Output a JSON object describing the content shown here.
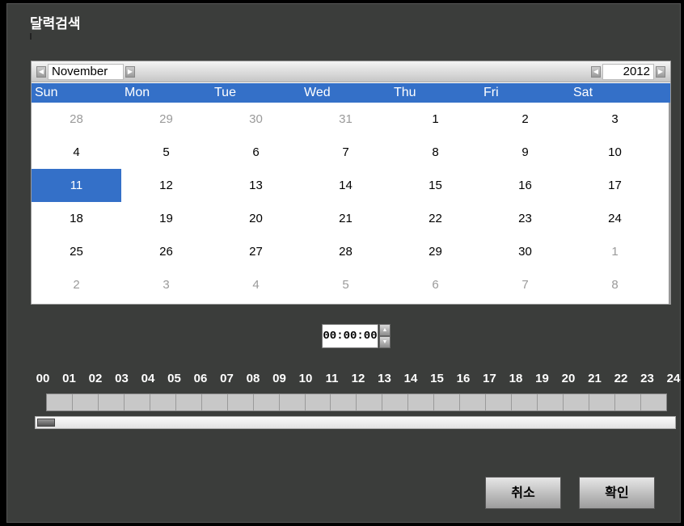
{
  "window": {
    "title": "달력검색"
  },
  "calendar": {
    "month": "November",
    "year": "2012",
    "weekdays": [
      "Sun",
      "Mon",
      "Tue",
      "Wed",
      "Thu",
      "Fri",
      "Sat"
    ],
    "weeks": [
      [
        {
          "d": "28",
          "dim": true
        },
        {
          "d": "29",
          "dim": true
        },
        {
          "d": "30",
          "dim": true
        },
        {
          "d": "31",
          "dim": true
        },
        {
          "d": "1"
        },
        {
          "d": "2"
        },
        {
          "d": "3"
        }
      ],
      [
        {
          "d": "4"
        },
        {
          "d": "5"
        },
        {
          "d": "6"
        },
        {
          "d": "7"
        },
        {
          "d": "8"
        },
        {
          "d": "9"
        },
        {
          "d": "10"
        }
      ],
      [
        {
          "d": "11",
          "sel": true
        },
        {
          "d": "12"
        },
        {
          "d": "13"
        },
        {
          "d": "14"
        },
        {
          "d": "15"
        },
        {
          "d": "16"
        },
        {
          "d": "17"
        }
      ],
      [
        {
          "d": "18"
        },
        {
          "d": "19"
        },
        {
          "d": "20"
        },
        {
          "d": "21"
        },
        {
          "d": "22"
        },
        {
          "d": "23"
        },
        {
          "d": "24"
        }
      ],
      [
        {
          "d": "25"
        },
        {
          "d": "26"
        },
        {
          "d": "27"
        },
        {
          "d": "28"
        },
        {
          "d": "29"
        },
        {
          "d": "30"
        },
        {
          "d": "1",
          "dim": true
        }
      ],
      [
        {
          "d": "2",
          "dim": true
        },
        {
          "d": "3",
          "dim": true
        },
        {
          "d": "4",
          "dim": true
        },
        {
          "d": "5",
          "dim": true
        },
        {
          "d": "6",
          "dim": true
        },
        {
          "d": "7",
          "dim": true
        },
        {
          "d": "8",
          "dim": true
        }
      ]
    ],
    "accent_color": "#3470c8"
  },
  "time": {
    "value": "00:00:00"
  },
  "timeline": {
    "hours": [
      "00",
      "01",
      "02",
      "03",
      "04",
      "05",
      "06",
      "07",
      "08",
      "09",
      "10",
      "11",
      "12",
      "13",
      "14",
      "15",
      "16",
      "17",
      "18",
      "19",
      "20",
      "21",
      "22",
      "23",
      "24"
    ],
    "slot_count": 24
  },
  "buttons": {
    "cancel": "취소",
    "ok": "확인"
  }
}
